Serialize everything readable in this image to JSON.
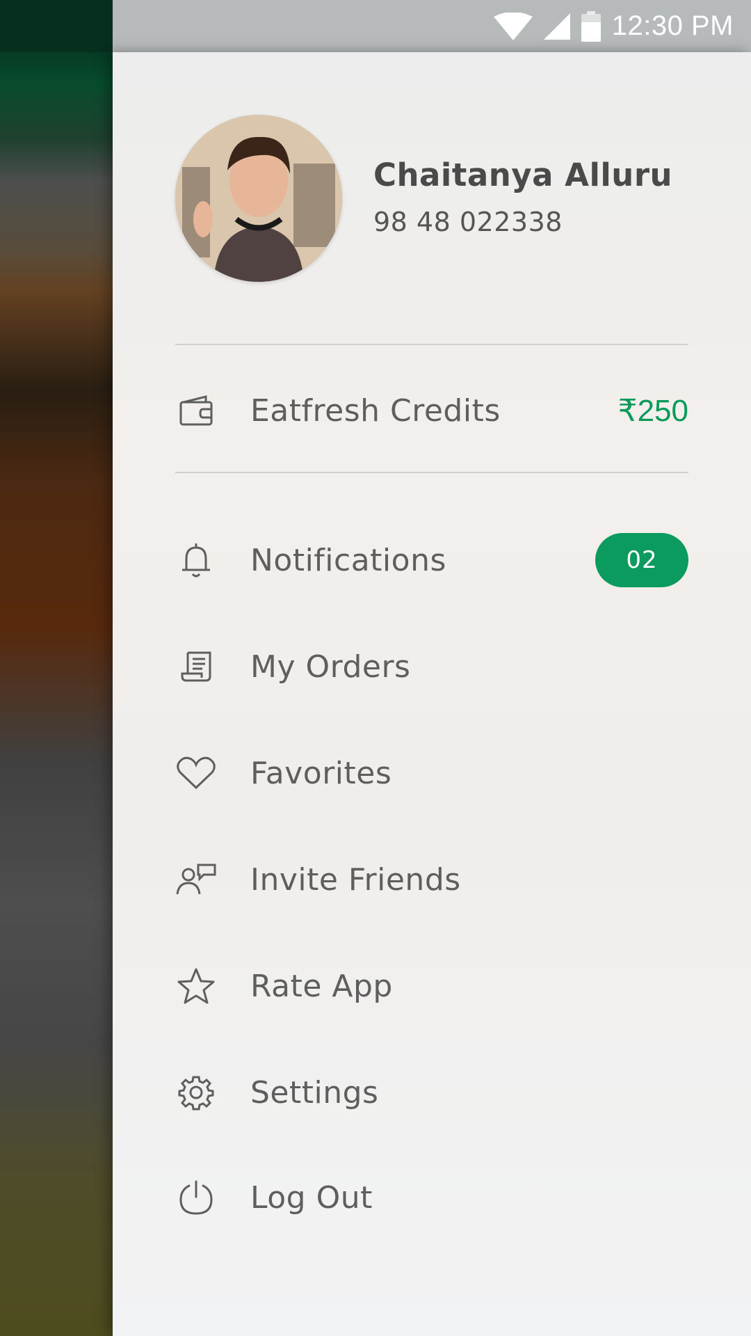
{
  "status_bar": {
    "time": "12:30 PM",
    "icons": [
      "wifi-icon",
      "cell-signal-icon",
      "battery-icon"
    ]
  },
  "profile": {
    "name": "Chaitanya Alluru",
    "phone": "98 48 022338"
  },
  "credits": {
    "label": "Eatfresh Credits",
    "value": "₹250",
    "icon": "wallet-icon"
  },
  "menu": {
    "items": [
      {
        "label": "Notifications",
        "icon": "bell-icon",
        "badge": "02"
      },
      {
        "label": "My Orders",
        "icon": "receipt-icon"
      },
      {
        "label": "Favorites",
        "icon": "heart-icon"
      },
      {
        "label": "Invite Friends",
        "icon": "invite-icon"
      },
      {
        "label": "Rate App",
        "icon": "star-icon"
      },
      {
        "label": "Settings",
        "icon": "gear-icon"
      },
      {
        "label": "Log Out",
        "icon": "power-icon"
      }
    ]
  },
  "colors": {
    "accent": "#0c9b5e",
    "status_bar": "#b7babb",
    "drawer_bg": "#f0eeec",
    "text": "#5e5e5e"
  }
}
